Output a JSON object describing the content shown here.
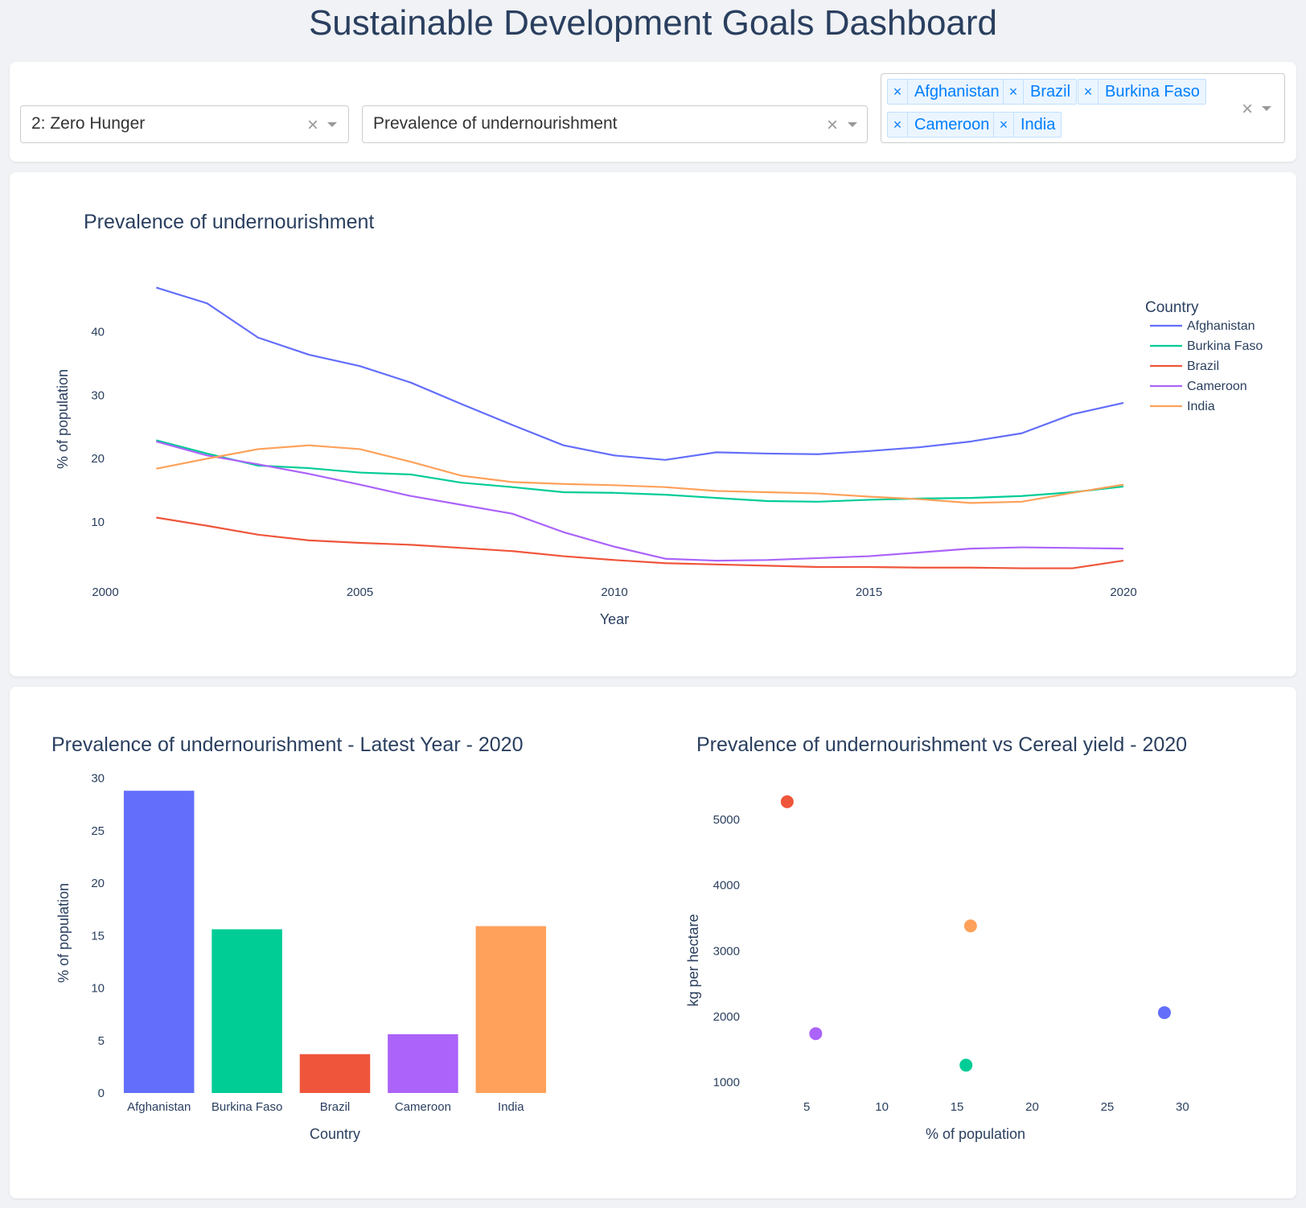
{
  "dashboard": {
    "title": "Sustainable Development Goals Dashboard"
  },
  "controls": {
    "goal": {
      "value": "2: Zero Hunger",
      "clear": "×"
    },
    "indicator": {
      "value": "Prevalence of undernourishment",
      "clear": "×"
    },
    "countries": {
      "tags": [
        "Afghanistan",
        "Brazil",
        "Burkina Faso",
        "Cameroon",
        "India"
      ],
      "remove": "×",
      "clear": "×"
    }
  },
  "colors": {
    "Afghanistan": "#636efa",
    "Burkina Faso": "#00cc96",
    "Brazil": "#ef553b",
    "Cameroon": "#ab63fa",
    "India": "#ffa15a",
    "grid_text": "#2a3f5f"
  },
  "chart_data": [
    {
      "type": "line",
      "title": "Prevalence of undernourishment",
      "xlabel": "Year",
      "ylabel": "% of population",
      "xlim": [
        2000,
        2020
      ],
      "ylim": [
        1.5,
        51
      ],
      "xticks": [
        2000,
        2005,
        2010,
        2015,
        2020
      ],
      "yticks": [
        10,
        20,
        30,
        40
      ],
      "legend_title": "Country",
      "legend_position": "top-right",
      "grid": false,
      "x": [
        2001,
        2002,
        2003,
        2004,
        2005,
        2006,
        2007,
        2008,
        2009,
        2010,
        2011,
        2012,
        2013,
        2014,
        2015,
        2016,
        2017,
        2018,
        2019,
        2020
      ],
      "series": [
        {
          "name": "Afghanistan",
          "values": [
            47.0,
            44.5,
            39.1,
            36.4,
            34.6,
            32.0,
            28.6,
            25.3,
            22.1,
            20.5,
            19.8,
            21.0,
            20.8,
            20.7,
            21.2,
            21.8,
            22.7,
            24.0,
            27.0,
            28.8
          ]
        },
        {
          "name": "Burkina Faso",
          "values": [
            22.9,
            20.8,
            18.9,
            18.5,
            17.8,
            17.5,
            16.2,
            15.5,
            14.7,
            14.6,
            14.3,
            13.8,
            13.3,
            13.2,
            13.5,
            13.7,
            13.8,
            14.1,
            14.7,
            15.6
          ]
        },
        {
          "name": "Brazil",
          "values": [
            10.7,
            9.4,
            8.0,
            7.1,
            6.7,
            6.4,
            5.9,
            5.4,
            4.6,
            4.0,
            3.5,
            3.3,
            3.1,
            2.9,
            2.9,
            2.8,
            2.8,
            2.7,
            2.7,
            3.9
          ]
        },
        {
          "name": "Cameroon",
          "values": [
            22.7,
            20.5,
            19.1,
            17.6,
            15.9,
            14.1,
            12.7,
            11.3,
            8.4,
            6.1,
            4.2,
            3.9,
            4.0,
            4.3,
            4.6,
            5.2,
            5.8,
            6.0,
            5.9,
            5.8
          ]
        },
        {
          "name": "India",
          "values": [
            18.4,
            20.0,
            21.5,
            22.1,
            21.5,
            19.5,
            17.3,
            16.3,
            16.0,
            15.8,
            15.5,
            14.9,
            14.7,
            14.5,
            14.0,
            13.6,
            13.0,
            13.2,
            14.6,
            15.9
          ]
        }
      ]
    },
    {
      "type": "bar",
      "title": "Prevalence of undernourishment - Latest Year - 2020",
      "xlabel": "Country",
      "ylabel": "% of population",
      "ylim": [
        0,
        30.5
      ],
      "yticks": [
        0,
        5,
        10,
        15,
        20,
        25,
        30
      ],
      "categories": [
        "Afghanistan",
        "Burkina Faso",
        "Brazil",
        "Cameroon",
        "India"
      ],
      "values": [
        28.8,
        15.6,
        3.7,
        5.6,
        15.9
      ]
    },
    {
      "type": "scatter",
      "title": "Prevalence of undernourishment vs Cereal yield - 2020",
      "xlabel": "% of population",
      "ylabel": "kg per hectare",
      "xlim": [
        1.3,
        31.8
      ],
      "ylim": [
        800,
        5550
      ],
      "xticks": [
        5,
        10,
        15,
        20,
        25,
        30
      ],
      "yticks": [
        1000,
        2000,
        3000,
        4000,
        5000
      ],
      "points": [
        {
          "name": "Brazil",
          "x": 3.7,
          "y": 5270
        },
        {
          "name": "India",
          "x": 15.9,
          "y": 3380
        },
        {
          "name": "Afghanistan",
          "x": 28.8,
          "y": 2060
        },
        {
          "name": "Cameroon",
          "x": 5.6,
          "y": 1740
        },
        {
          "name": "Burkina Faso",
          "x": 15.6,
          "y": 1260
        }
      ]
    }
  ]
}
